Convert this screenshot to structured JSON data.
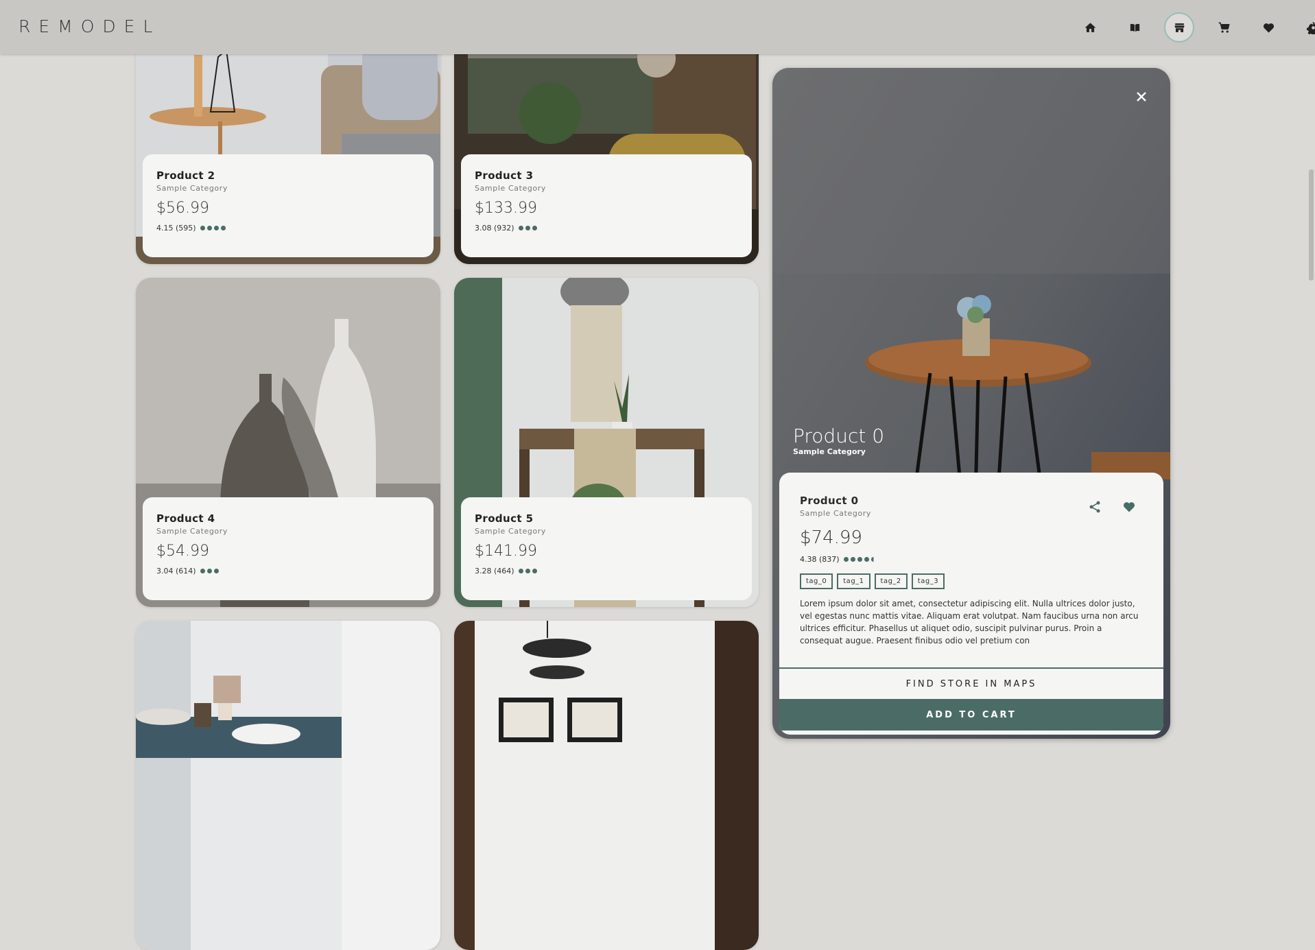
{
  "app": {
    "logo": "REMODEL"
  },
  "nav": [
    {
      "icon": "home-icon",
      "active": false
    },
    {
      "icon": "catalog-icon",
      "active": false
    },
    {
      "icon": "store-icon",
      "active": true
    },
    {
      "icon": "cart-icon",
      "active": false
    },
    {
      "icon": "favorites-icon",
      "active": false
    },
    {
      "icon": "settings-icon",
      "active": false
    }
  ],
  "products": [
    {
      "name": "Product 2",
      "category": "Sample Category",
      "price": "$56.99",
      "rating": "4.15 (595)",
      "stars": 4
    },
    {
      "name": "Product 3",
      "category": "Sample Category",
      "price": "$133.99",
      "rating": "3.08 (932)",
      "stars": 3
    },
    {
      "name": "Product 4",
      "category": "Sample Category",
      "price": "$54.99",
      "rating": "3.04 (614)",
      "stars": 3
    },
    {
      "name": "Product 5",
      "category": "Sample Category",
      "price": "$141.99",
      "rating": "3.28 (464)",
      "stars": 3
    }
  ],
  "detail": {
    "overlay_name": "Product 0",
    "overlay_category": "Sample Category",
    "name": "Product 0",
    "category": "Sample Category",
    "price": "$74.99",
    "rating": "4.38 (837)",
    "stars": 4.5,
    "tags": [
      "tag_0",
      "tag_1",
      "tag_2",
      "tag_3"
    ],
    "description": "Lorem ipsum dolor sit amet, consectetur adipiscing elit. Nulla ultrices dolor justo, vel egestas nunc mattis vitae. Aliquam erat volutpat. Nam faucibus urna non arcu ultrices efficitur. Phasellus ut aliquet odio, suscipit pulvinar purus. Proin a consequat augue. Praesent finibus odio vel pretium con",
    "find_store_label": "FIND STORE IN MAPS",
    "add_to_cart_label": "ADD TO CART"
  },
  "colors": {
    "accent": "#4b6c66",
    "header_bg": "#c9c7c3",
    "page_bg": "#dcdad6"
  }
}
